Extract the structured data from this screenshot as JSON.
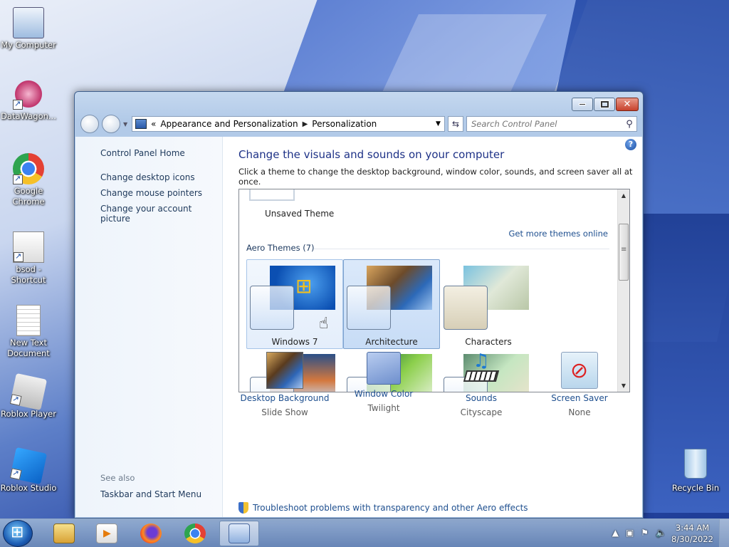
{
  "desktop": {
    "icons": [
      {
        "label": "My Computer"
      },
      {
        "label": "DataWagon..."
      },
      {
        "label": "Google Chrome"
      },
      {
        "label": "bsod - Shortcut"
      },
      {
        "label": "New Text Document"
      },
      {
        "label": "Roblox Player"
      },
      {
        "label": "Roblox Studio"
      }
    ],
    "recycle_bin": "Recycle Bin"
  },
  "window": {
    "breadcrumb": {
      "overflow": "«",
      "items": [
        "Appearance and Personalization",
        "Personalization"
      ]
    },
    "search": {
      "placeholder": "Search Control Panel"
    },
    "left_pane": {
      "home": "Control Panel Home",
      "links": [
        "Change desktop icons",
        "Change mouse pointers",
        "Change your account picture"
      ],
      "see_also": "See also",
      "see_also_links": [
        "Taskbar and Start Menu"
      ]
    },
    "main": {
      "heading": "Change the visuals and sounds on your computer",
      "subtext": "Click a theme to change the desktop background, window color, sounds, and screen saver all at once.",
      "unsaved_theme": "Unsaved Theme",
      "get_more": "Get more themes online",
      "group_title": "Aero Themes (7)",
      "themes": [
        "Windows 7",
        "Architecture",
        "Characters",
        "",
        "",
        ""
      ],
      "bottom": [
        {
          "name": "Desktop Background",
          "value": "Slide Show"
        },
        {
          "name": "Window Color",
          "value": "Twilight"
        },
        {
          "name": "Sounds",
          "value": "Cityscape"
        },
        {
          "name": "Screen Saver",
          "value": "None"
        }
      ],
      "troubleshoot": "Troubleshoot problems with transparency and other Aero effects"
    }
  },
  "taskbar": {
    "items": [
      "start-button",
      "windows-explorer",
      "media-player",
      "firefox",
      "chrome",
      "control-panel"
    ],
    "time": "3:44 AM",
    "date": "8/30/2022"
  }
}
